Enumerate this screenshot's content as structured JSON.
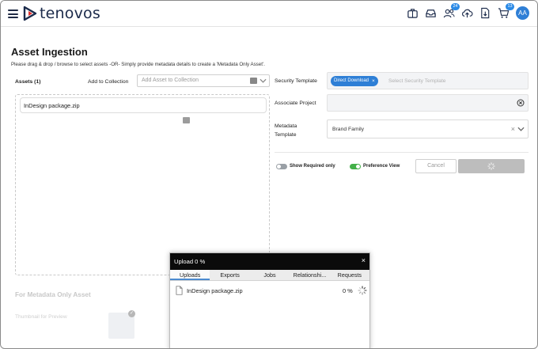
{
  "header": {
    "brand": "tenovos",
    "icons": [
      {
        "name": "briefcase-icon"
      },
      {
        "name": "inbox-icon"
      },
      {
        "name": "users-icon",
        "badge": "24"
      },
      {
        "name": "upload-cloud-icon"
      },
      {
        "name": "download-document-icon"
      },
      {
        "name": "cart-icon",
        "badge": "13"
      }
    ],
    "avatar": "AA"
  },
  "page": {
    "title": "Asset Ingestion",
    "subtitle": "Please drag & drop / browse to select assets -OR- Simply provide metadata details to create a 'Metadata Only Asset'."
  },
  "assets": {
    "label": "Assets (1)",
    "add_to_collection_label": "Add to Collection",
    "add_to_collection_placeholder": "Add Asset to Collection",
    "files": [
      "InDesign package.zip"
    ]
  },
  "metadata_only": {
    "heading": "For Metadata Only Asset",
    "thumbnail_label": "Thumbnail for Preview"
  },
  "form": {
    "security_template_label": "Security Template",
    "security_tag": "Direct Download",
    "security_placeholder": "Select Security Template",
    "associate_project_label": "Associate Project",
    "metadata_template_label": "Metadata Template",
    "metadata_template_value": "Brand Family",
    "show_required_label": "Show Required only",
    "show_required_on": false,
    "preference_view_label": "Preference View",
    "preference_view_on": true,
    "cancel_label": "Cancel"
  },
  "upload_panel": {
    "title": "Upload 0 %",
    "close": "×",
    "tabs": [
      "Uploads",
      "Exports",
      "Jobs",
      "Relationshi...",
      "Requests"
    ],
    "active_tab": "Uploads",
    "items": [
      {
        "name": "InDesign package.zip",
        "progress": "0 %"
      }
    ]
  },
  "colors": {
    "brand_navy": "#1b2a4a",
    "accent_blue": "#2e7fd6",
    "toggle_green": "#43b049"
  }
}
